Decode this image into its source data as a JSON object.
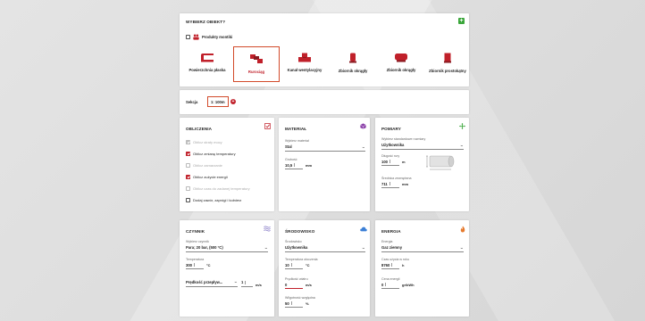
{
  "object_select": {
    "title": "WYBIERZ OBIEKT?",
    "group_label": "Produkty montiki",
    "products": [
      {
        "label": "Powierzchnia płaska",
        "icon": "flat-surface-icon"
      },
      {
        "label": "Rurociąg",
        "icon": "pipeline-icon",
        "selected": true
      },
      {
        "label": "Kanał wentylacyjny",
        "icon": "vent-duct-icon"
      },
      {
        "label": "Zbiornik okrągły",
        "icon": "round-tank-vertical-icon"
      },
      {
        "label": "Zbiornik okrągły",
        "icon": "round-tank-horizontal-icon"
      },
      {
        "label": "Zbiornik prostokątny",
        "icon": "rect-tank-icon"
      }
    ]
  },
  "section": {
    "label": "Sekcja",
    "value": "1: 100m"
  },
  "obliczenia": {
    "title": "OBLICZENIA",
    "items": [
      {
        "label": "Oblicz straty mocy",
        "checked": true,
        "disabled": true
      },
      {
        "label": "Oblicz zmianę temperatury",
        "checked": true,
        "disabled": false
      },
      {
        "label": "Oblicz zamarzanie",
        "checked": false,
        "disabled": true
      },
      {
        "label": "Oblicz zużycie energii",
        "checked": true,
        "disabled": false
      },
      {
        "label": "Oblicz czas do zadanej temperatury",
        "checked": false,
        "disabled": true
      },
      {
        "label": "Dodaj zawór, zaprógi i kołnierz",
        "checked": false,
        "disabled": false
      }
    ]
  },
  "material": {
    "title": "MATERIAŁ",
    "type_label": "Wybierz materiał",
    "type_value": "Stal",
    "thickness_label": "Grubość",
    "thickness_value": "10,5",
    "thickness_unit": "mm"
  },
  "pomiary": {
    "title": "POMIARY",
    "std_label": "Wybierz standardowe rozmiary",
    "std_value": "Użytkownika",
    "length_label": "Długość rury",
    "length_value": "100",
    "length_unit": "m",
    "diam_label": "Średnica zewnętrzna",
    "diam_value": "711",
    "diam_unit": "mm"
  },
  "czynnik": {
    "title": "CZYNNIK",
    "type_label": "Wybierz czynnik",
    "type_value": "Para; 20 bar, (500 °C)",
    "temp_label": "Temperatura",
    "temp_value": "300",
    "temp_unit": "°C",
    "flow_label": "Prędkość przepływ...",
    "flow_value": "1",
    "flow_unit": "m/s"
  },
  "srodowisko": {
    "title": "ŚRODOWISKO",
    "type_label": "Środowisko",
    "type_value": "Użytkownika",
    "temp_label": "Temperatura otoczenia",
    "temp_value": "10",
    "temp_unit": "°C",
    "wind_label": "Prędkość wiatru",
    "wind_value": "0",
    "wind_unit": "m/s",
    "hum_label": "Wilgotność względna",
    "hum_value": "50",
    "hum_unit": "%"
  },
  "energia": {
    "title": "ENERGIA",
    "type_label": "Energia",
    "type_value": "Gaz ziemny",
    "time_label": "Czas użycia w roku",
    "time_value": "8760",
    "time_unit": "h",
    "price_label": "Cena energii",
    "price_value": "0",
    "price_unit": "gr/kWh"
  },
  "colors": {
    "accent": "#c0202a",
    "green": "#3aa63a",
    "purple": "#8a3fa8",
    "blue": "#3b7fd6",
    "orange": "#e67a2e"
  }
}
